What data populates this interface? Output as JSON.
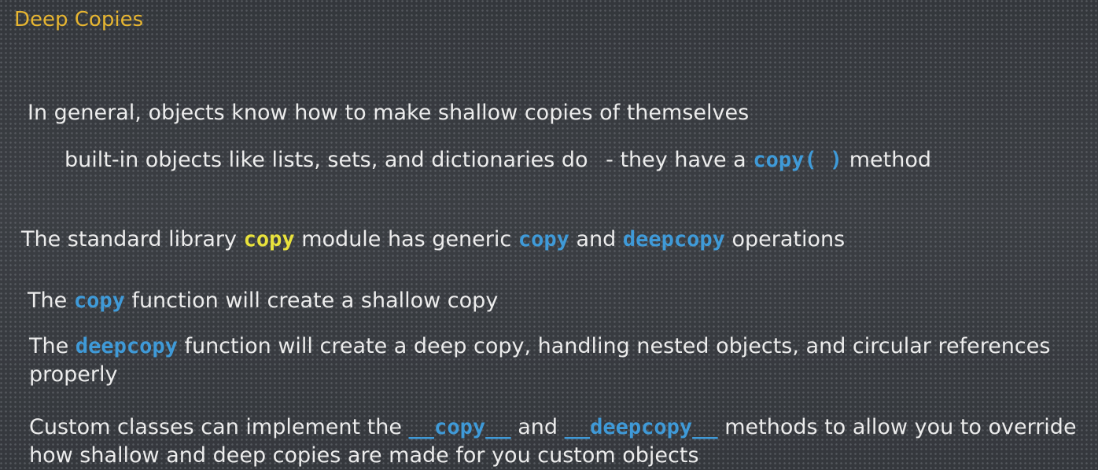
{
  "slide": {
    "title": "Deep Copies",
    "title_color": "#e6b531",
    "code_color": "#3f9ad8",
    "module_color": "#e8e23c"
  },
  "lines": {
    "l1": {
      "text": "In general, objects know how to make shallow copies of themselves"
    },
    "l2": {
      "pre": "built-in objects like lists, sets, and dictionaries do",
      "mid": "- they have a",
      "code": "copy( )",
      "post": "method"
    },
    "l3": {
      "pre": "The standard library",
      "module": "copy",
      "mid1": "module has generic",
      "code1": "copy",
      "mid2": "and",
      "code2": "deepcopy",
      "post": "operations"
    },
    "l4": {
      "pre": "The",
      "code": "copy",
      "post": "function will create a shallow copy"
    },
    "l5": {
      "pre": "The",
      "code": "deepcopy",
      "post": "function will create a deep copy, handling nested objects, and circular references properly"
    },
    "l6": {
      "pre": "Custom classes can implement the",
      "code1": "__copy__",
      "mid": "and",
      "code2": "__deepcopy__",
      "post": "methods to allow you to override how shallow and deep copies are made for you custom objects"
    }
  }
}
